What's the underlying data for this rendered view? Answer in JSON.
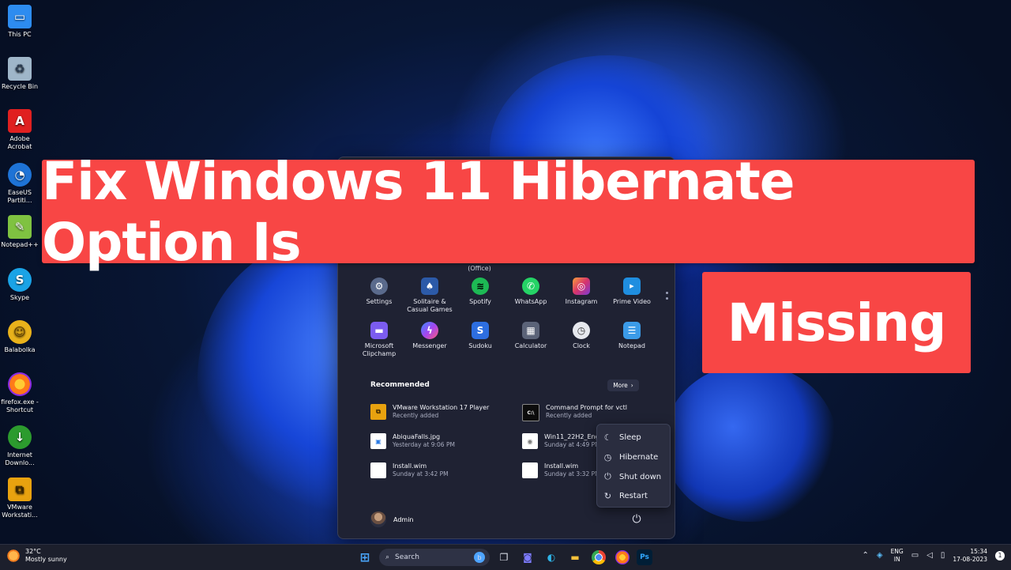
{
  "desktop": {
    "icons": [
      {
        "label": "This PC",
        "icon": "monitor-icon",
        "color": "#2d8cf0"
      },
      {
        "label": "Recycle Bin",
        "icon": "recycle-bin-icon",
        "color": "#9fb6c9"
      },
      {
        "label": "Adobe Acrobat",
        "icon": "pdf-icon",
        "color": "#e02020"
      },
      {
        "label": "EaseUS Partiti...",
        "icon": "easeus-icon",
        "color": "#1e73d6"
      },
      {
        "label": "Notepad++",
        "icon": "notepad-plus-icon",
        "color": "#7fc241"
      },
      {
        "label": "Skype",
        "icon": "skype-icon",
        "color": "#1aa3e6"
      },
      {
        "label": "Balabolka",
        "icon": "balabolka-icon",
        "color": "#e9b21b"
      },
      {
        "label": "firefox.exe - Shortcut",
        "icon": "firefox-icon",
        "color": "#ff7a18"
      },
      {
        "label": "Internet Downlo...",
        "icon": "idm-icon",
        "color": "#2c9b2e"
      },
      {
        "label": "VMware Workstati...",
        "icon": "vmware-icon",
        "color": "#e8a20f"
      }
    ]
  },
  "banner": {
    "title": "Fix Windows 11 Hibernate Option Is",
    "subtitle": "Missing",
    "color": "#f84645"
  },
  "start_menu": {
    "office_label": "(Office)",
    "pinned": [
      {
        "label": "Settings",
        "icon": "gear-icon",
        "color": "#5a6a8c"
      },
      {
        "label": "Solitaire & Casual Games",
        "icon": "cards-icon",
        "color": "#2c5aa8"
      },
      {
        "label": "Spotify",
        "icon": "spotify-icon",
        "color": "#1db954"
      },
      {
        "label": "WhatsApp",
        "icon": "whatsapp-icon",
        "color": "#25d366"
      },
      {
        "label": "Instagram",
        "icon": "instagram-icon",
        "color": "#d6336c"
      },
      {
        "label": "Prime Video",
        "icon": "prime-video-icon",
        "color": "#1f8ee0"
      },
      {
        "label": "Microsoft Clipchamp",
        "icon": "clipchamp-icon",
        "color": "#7b5cf0"
      },
      {
        "label": "Messenger",
        "icon": "messenger-icon",
        "color": "#a246f0"
      },
      {
        "label": "Sudoku",
        "icon": "sudoku-icon",
        "color": "#2d6ee0"
      },
      {
        "label": "Calculator",
        "icon": "calculator-icon",
        "color": "#5b6378"
      },
      {
        "label": "Clock",
        "icon": "clock-icon",
        "color": "#a8acb8"
      },
      {
        "label": "Notepad",
        "icon": "notepad-icon",
        "color": "#3b9be8"
      }
    ],
    "recommended_title": "Recommended",
    "more_label": "More",
    "recommended": [
      {
        "name": "VMware Workstation 17 Player",
        "sub": "Recently added",
        "icon": "vmware-icon",
        "color": "#e8a20f"
      },
      {
        "name": "Command Prompt for vctl",
        "sub": "Recently added",
        "icon": "terminal-icon",
        "color": "#0c0c0c"
      },
      {
        "name": "AbiquaFalls.jpg",
        "sub": "Yesterday at 9:06 PM",
        "icon": "image-file-icon",
        "color": "#ffffff"
      },
      {
        "name": "Win11_22H2_Engli",
        "sub": "Sunday at 4:49 PM",
        "icon": "disc-image-icon",
        "color": "#ffffff"
      },
      {
        "name": "Install.wim",
        "sub": "Sunday at 3:42 PM",
        "icon": "file-icon",
        "color": "#ffffff"
      },
      {
        "name": "Install.wim",
        "sub": "Sunday at 3:32 PM",
        "icon": "file-icon",
        "color": "#ffffff"
      }
    ],
    "user": "Admin"
  },
  "power_menu": {
    "items": [
      {
        "label": "Sleep",
        "icon": "moon-icon"
      },
      {
        "label": "Hibernate",
        "icon": "clock-icon"
      },
      {
        "label": "Shut down",
        "icon": "power-icon"
      },
      {
        "label": "Restart",
        "icon": "restart-icon"
      }
    ]
  },
  "taskbar": {
    "weather_temp": "32°C",
    "weather_desc": "Mostly sunny",
    "search_label": "Search",
    "lang_top": "ENG",
    "lang_bottom": "IN",
    "time": "15:34",
    "date": "17-08-2023"
  }
}
